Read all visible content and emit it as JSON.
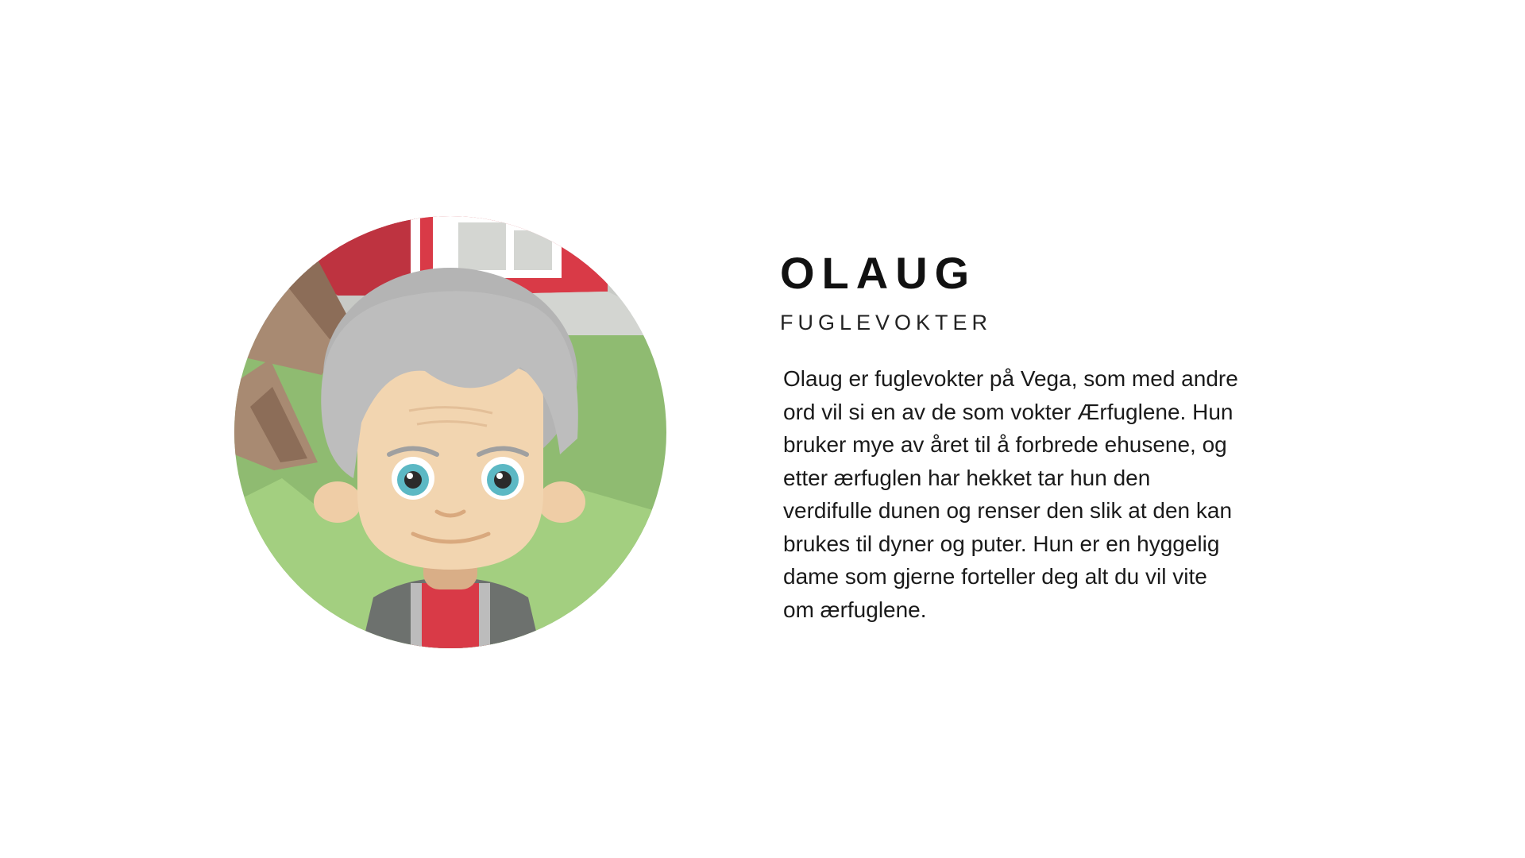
{
  "character": {
    "name": "OLAUG",
    "role": "FUGLEVOKTER",
    "description": "Olaug er fuglevokter på Vega, som med andre ord vil si en av de som vokter Ærfuglene. Hun bruker mye av året til å forbrede ehusene, og etter ærfuglen har hekket tar hun den verdifulle dunen og renser den slik at den kan brukes til dyner og puter. Hun er en hyggelig dame som gjerne forteller deg alt du vil vite om ærfuglene."
  },
  "colors": {
    "barn_red": "#d93a47",
    "grass": "#8fbb71",
    "hair": "#bdbdbd",
    "skin": "#f2d5b0",
    "eyes": "#5cb8c4"
  }
}
